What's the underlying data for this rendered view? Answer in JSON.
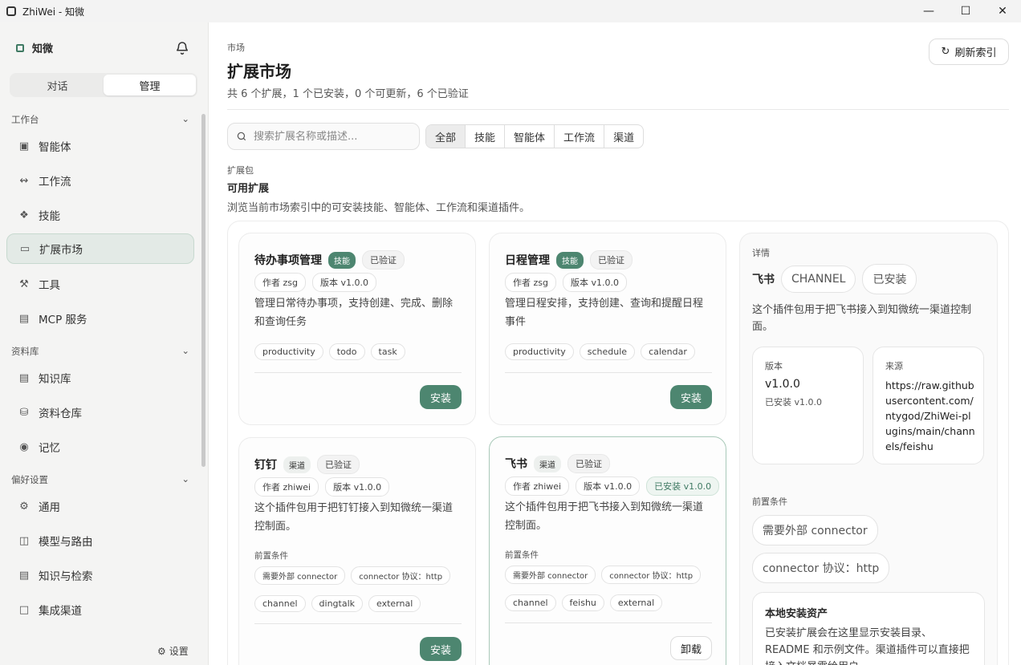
{
  "window": {
    "title": "ZhiWei - 知微"
  },
  "sidebar": {
    "brand": "知微",
    "segments": [
      "对话",
      "管理"
    ],
    "sections": [
      {
        "label": "工作台",
        "items": [
          "智能体",
          "工作流",
          "技能",
          "扩展市场",
          "工具",
          "MCP 服务"
        ]
      },
      {
        "label": "资料库",
        "items": [
          "知识库",
          "资料仓库",
          "记忆"
        ]
      },
      {
        "label": "偏好设置",
        "items": [
          "通用",
          "模型与路由",
          "知识与检索",
          "集成渠道"
        ]
      }
    ],
    "settings_label": "设置"
  },
  "header": {
    "breadcrumb": "市场",
    "title": "扩展市场",
    "summary": "共 6 个扩展，1 个已安装，0 个可更新，6 个已验证",
    "refresh_label": "刷新索引"
  },
  "search": {
    "placeholder": "搜索扩展名称或描述..."
  },
  "filters": [
    "全部",
    "技能",
    "智能体",
    "工作流",
    "渠道"
  ],
  "package": {
    "label": "扩展包",
    "title": "可用扩展",
    "description": "浏览当前市场索引中的可安装技能、智能体、工作流和渠道插件。"
  },
  "cards": [
    {
      "name": "待办事项管理",
      "kind": "技能",
      "verified": "已验证",
      "author": "作者 zsg",
      "version": "版本 v1.0.0",
      "description": "管理日常待办事项，支持创建、完成、删除和查询任务",
      "tags": [
        "productivity",
        "todo",
        "task"
      ],
      "action": "安装"
    },
    {
      "name": "日程管理",
      "kind": "技能",
      "verified": "已验证",
      "author": "作者 zsg",
      "version": "版本 v1.0.0",
      "description": "管理日程安排，支持创建、查询和提醒日程事件",
      "tags": [
        "productivity",
        "schedule",
        "calendar"
      ],
      "action": "安装"
    },
    {
      "name": "钉钉",
      "kind": "渠道",
      "verified": "已验证",
      "author": "作者 zhiwei",
      "version": "版本 v1.0.0",
      "description": "这个插件包用于把钉钉接入到知微统一渠道控制面。",
      "prereq_label": "前置条件",
      "prereqs": [
        "需要外部 connector",
        "connector 协议：http"
      ],
      "tags": [
        "channel",
        "dingtalk",
        "external"
      ],
      "action": "安装"
    },
    {
      "name": "飞书",
      "kind": "渠道",
      "verified": "已验证",
      "author": "作者 zhiwei",
      "version": "版本 v1.0.0",
      "installed": "已安装 v1.0.0",
      "description": "这个插件包用于把飞书接入到知微统一渠道控制面。",
      "prereq_label": "前置条件",
      "prereqs": [
        "需要外部 connector",
        "connector 协议：http"
      ],
      "tags": [
        "channel",
        "feishu",
        "external"
      ],
      "action": "卸载"
    }
  ],
  "detail": {
    "label": "详情",
    "name": "飞书",
    "kind": "CHANNEL",
    "status": "已安装",
    "description": "这个插件包用于把飞书接入到知微统一渠道控制面。",
    "version_label": "版本",
    "version": "v1.0.0",
    "installed_version": "已安装 v1.0.0",
    "source_label": "来源",
    "source": "https://raw.githubusercontent.com/ntygod/ZhiWei-plugins/main/channels/feishu",
    "prereq_label": "前置条件",
    "prereqs": [
      "需要外部 connector",
      "connector 协议：http"
    ],
    "assets_title": "本地安装资产",
    "assets_desc": "已安装扩展会在这里显示安装目录、README 和示例文件。渠道插件可以直接把接入文档暴露给用户。"
  },
  "colors": {
    "accent": "#4d8670",
    "accent_light": "#e3eae6"
  }
}
